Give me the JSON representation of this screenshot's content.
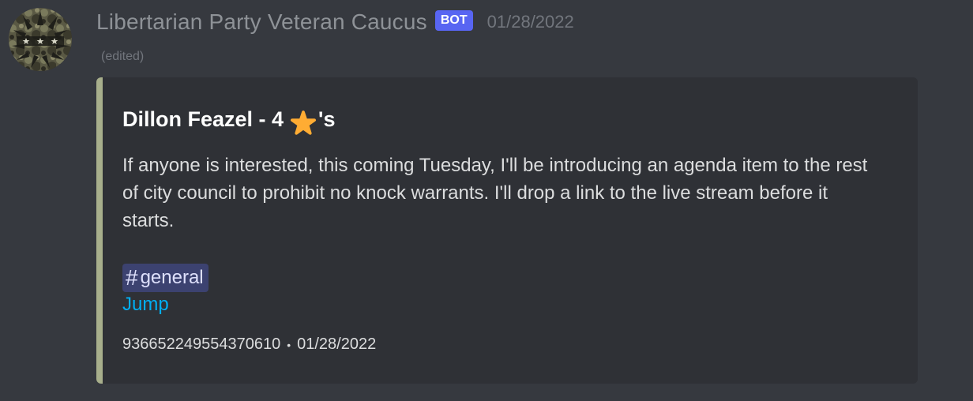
{
  "author": {
    "name": "Libertarian Party Veteran Caucus",
    "bot_tag": "BOT",
    "timestamp": "01/28/2022",
    "edited_label": "(edited)",
    "avatar_icon": "porcupine-stars-avatar"
  },
  "embed": {
    "accent_color": "#a8af8c",
    "title_prefix": "Dillon Feazel - 4",
    "title_icon": "star-icon",
    "title_suffix": "'s",
    "description": "If anyone is interested, this coming Tuesday, I'll be introducing an agenda item to the rest of city council to prohibit no knock warrants. I'll drop a link to the live stream before it starts.",
    "channel_hash": "#",
    "channel_name": "general",
    "jump_label": "Jump",
    "footer_id": "936652249554370610",
    "footer_separator": "•",
    "footer_date": "01/28/2022"
  },
  "colors": {
    "background": "#36393f",
    "embed_background": "#2f3136",
    "bot_tag": "#5865f2",
    "link": "#00aff4",
    "mention_bg": "#3c4270",
    "star": "#ffac33"
  }
}
